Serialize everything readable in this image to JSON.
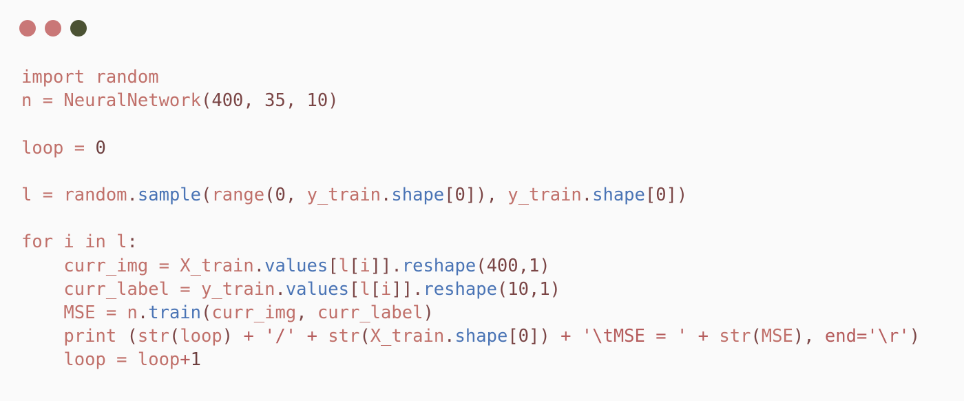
{
  "window_controls": {
    "close_color": "#c97777",
    "minimize_color": "#c97777",
    "zoom_color": "#4b5233"
  },
  "colors": {
    "background": "#fafafa",
    "keyword": "#b55c5c",
    "identifier": "#c0706a",
    "attribute": "#4a74b5",
    "number": "#6d3f3f",
    "string": "#b55c5c",
    "punctuation": "#7a4545"
  },
  "code": {
    "lines": [
      [
        {
          "t": "import random",
          "k": "identifier"
        }
      ],
      [
        {
          "t": "n = NeuralNetwork",
          "k": "identifier"
        },
        {
          "t": "(400, 35, 10)",
          "k": "punctuation"
        }
      ],
      [],
      [
        {
          "t": "loop = ",
          "k": "identifier"
        },
        {
          "t": "0",
          "k": "number"
        }
      ],
      [],
      [
        {
          "t": "l = random",
          "k": "identifier"
        },
        {
          "t": ".",
          "k": "punctuation"
        },
        {
          "t": "sample",
          "k": "attribute"
        },
        {
          "t": "(",
          "k": "punctuation"
        },
        {
          "t": "range",
          "k": "identifier"
        },
        {
          "t": "(0, ",
          "k": "punctuation"
        },
        {
          "t": "y_train",
          "k": "identifier"
        },
        {
          "t": ".",
          "k": "punctuation"
        },
        {
          "t": "shape",
          "k": "attribute"
        },
        {
          "t": "[0]), ",
          "k": "punctuation"
        },
        {
          "t": "y_train",
          "k": "identifier"
        },
        {
          "t": ".",
          "k": "punctuation"
        },
        {
          "t": "shape",
          "k": "attribute"
        },
        {
          "t": "[0])",
          "k": "punctuation"
        }
      ],
      [],
      [
        {
          "t": "for i in l",
          "k": "identifier"
        },
        {
          "t": ":",
          "k": "punctuation"
        }
      ],
      [
        {
          "t": "    curr_img = X_train",
          "k": "identifier"
        },
        {
          "t": ".",
          "k": "punctuation"
        },
        {
          "t": "values",
          "k": "attribute"
        },
        {
          "t": "[",
          "k": "punctuation"
        },
        {
          "t": "l",
          "k": "identifier"
        },
        {
          "t": "[",
          "k": "punctuation"
        },
        {
          "t": "i",
          "k": "identifier"
        },
        {
          "t": "]].",
          "k": "punctuation"
        },
        {
          "t": "reshape",
          "k": "attribute"
        },
        {
          "t": "(400,1)",
          "k": "punctuation"
        }
      ],
      [
        {
          "t": "    curr_label = y_train",
          "k": "identifier"
        },
        {
          "t": ".",
          "k": "punctuation"
        },
        {
          "t": "values",
          "k": "attribute"
        },
        {
          "t": "[",
          "k": "punctuation"
        },
        {
          "t": "l",
          "k": "identifier"
        },
        {
          "t": "[",
          "k": "punctuation"
        },
        {
          "t": "i",
          "k": "identifier"
        },
        {
          "t": "]].",
          "k": "punctuation"
        },
        {
          "t": "reshape",
          "k": "attribute"
        },
        {
          "t": "(10,1)",
          "k": "punctuation"
        }
      ],
      [
        {
          "t": "    MSE = n",
          "k": "identifier"
        },
        {
          "t": ".",
          "k": "punctuation"
        },
        {
          "t": "train",
          "k": "attribute"
        },
        {
          "t": "(",
          "k": "punctuation"
        },
        {
          "t": "curr_img",
          "k": "identifier"
        },
        {
          "t": ", ",
          "k": "punctuation"
        },
        {
          "t": "curr_label",
          "k": "identifier"
        },
        {
          "t": ")",
          "k": "punctuation"
        }
      ],
      [
        {
          "t": "    print ",
          "k": "identifier"
        },
        {
          "t": "(",
          "k": "punctuation"
        },
        {
          "t": "str",
          "k": "identifier"
        },
        {
          "t": "(",
          "k": "punctuation"
        },
        {
          "t": "loop",
          "k": "identifier"
        },
        {
          "t": ") ",
          "k": "punctuation"
        },
        {
          "t": "+ '/' + ",
          "k": "string"
        },
        {
          "t": "str",
          "k": "identifier"
        },
        {
          "t": "(",
          "k": "punctuation"
        },
        {
          "t": "X_train",
          "k": "identifier"
        },
        {
          "t": ".",
          "k": "punctuation"
        },
        {
          "t": "shape",
          "k": "attribute"
        },
        {
          "t": "[0]) ",
          "k": "punctuation"
        },
        {
          "t": "+ '\\tMSE = ' + ",
          "k": "string"
        },
        {
          "t": "str",
          "k": "identifier"
        },
        {
          "t": "(",
          "k": "punctuation"
        },
        {
          "t": "MSE",
          "k": "identifier"
        },
        {
          "t": "), ",
          "k": "punctuation"
        },
        {
          "t": "end='\\r'",
          "k": "string"
        },
        {
          "t": ")",
          "k": "punctuation"
        }
      ],
      [
        {
          "t": "    loop = loop",
          "k": "identifier"
        },
        {
          "t": "+",
          "k": "string"
        },
        {
          "t": "1",
          "k": "number"
        }
      ]
    ]
  }
}
